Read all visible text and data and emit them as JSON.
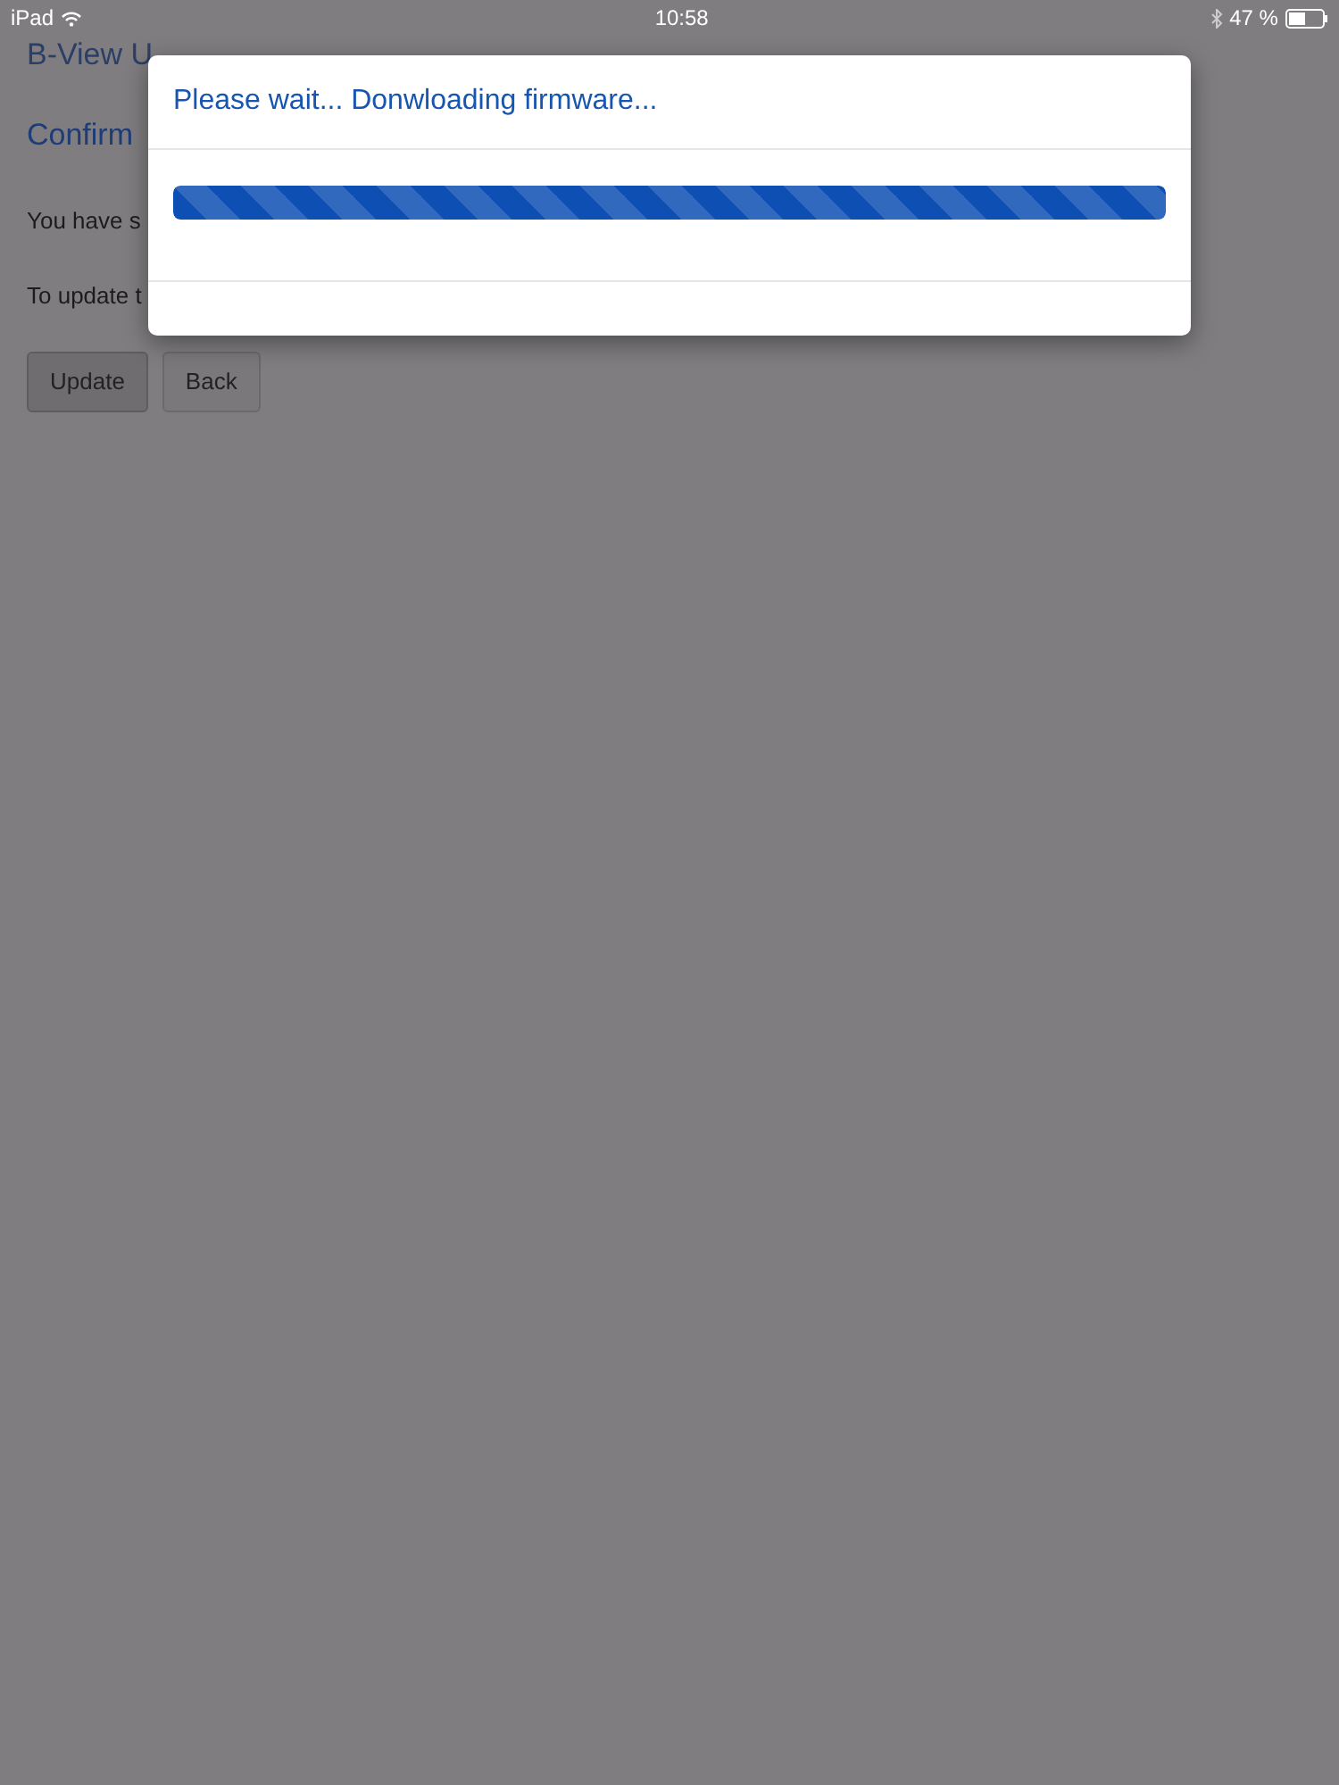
{
  "status_bar": {
    "device": "iPad",
    "time": "10:58",
    "battery": "47 %"
  },
  "navbar": {
    "brand": "B-View U"
  },
  "page": {
    "heading": "Confirm",
    "lines": [
      "You have s",
      "To update t"
    ],
    "buttons": [
      {
        "label": "Update",
        "selected": true
      },
      {
        "label": "Back",
        "selected": false
      }
    ]
  },
  "modal": {
    "title": "Please wait... Donwloading firmware...",
    "progress": {
      "level": 1.0,
      "striped": true
    }
  }
}
